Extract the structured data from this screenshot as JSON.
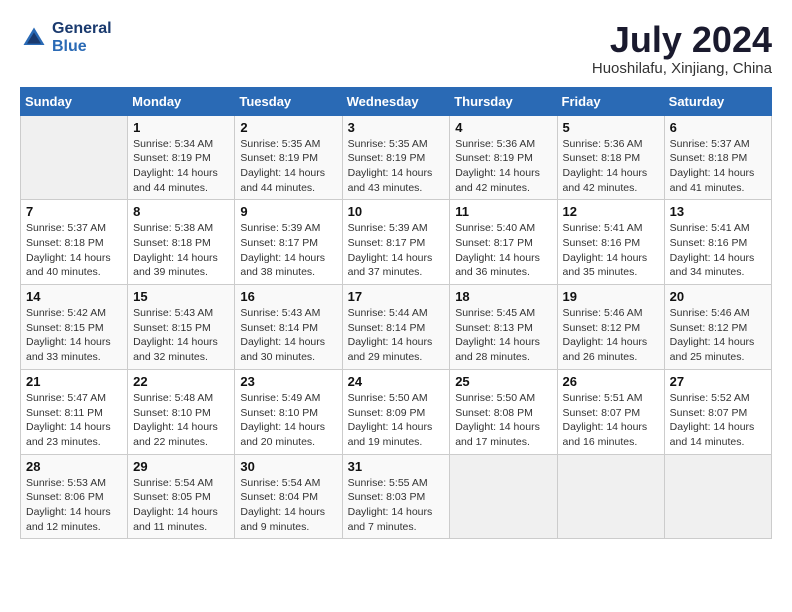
{
  "header": {
    "logo_line1": "General",
    "logo_line2": "Blue",
    "month": "July 2024",
    "location": "Huoshilafu, Xinjiang, China"
  },
  "weekdays": [
    "Sunday",
    "Monday",
    "Tuesday",
    "Wednesday",
    "Thursday",
    "Friday",
    "Saturday"
  ],
  "weeks": [
    [
      {
        "day": "",
        "info": ""
      },
      {
        "day": "1",
        "info": "Sunrise: 5:34 AM\nSunset: 8:19 PM\nDaylight: 14 hours\nand 44 minutes."
      },
      {
        "day": "2",
        "info": "Sunrise: 5:35 AM\nSunset: 8:19 PM\nDaylight: 14 hours\nand 44 minutes."
      },
      {
        "day": "3",
        "info": "Sunrise: 5:35 AM\nSunset: 8:19 PM\nDaylight: 14 hours\nand 43 minutes."
      },
      {
        "day": "4",
        "info": "Sunrise: 5:36 AM\nSunset: 8:19 PM\nDaylight: 14 hours\nand 42 minutes."
      },
      {
        "day": "5",
        "info": "Sunrise: 5:36 AM\nSunset: 8:18 PM\nDaylight: 14 hours\nand 42 minutes."
      },
      {
        "day": "6",
        "info": "Sunrise: 5:37 AM\nSunset: 8:18 PM\nDaylight: 14 hours\nand 41 minutes."
      }
    ],
    [
      {
        "day": "7",
        "info": "Sunrise: 5:37 AM\nSunset: 8:18 PM\nDaylight: 14 hours\nand 40 minutes."
      },
      {
        "day": "8",
        "info": "Sunrise: 5:38 AM\nSunset: 8:18 PM\nDaylight: 14 hours\nand 39 minutes."
      },
      {
        "day": "9",
        "info": "Sunrise: 5:39 AM\nSunset: 8:17 PM\nDaylight: 14 hours\nand 38 minutes."
      },
      {
        "day": "10",
        "info": "Sunrise: 5:39 AM\nSunset: 8:17 PM\nDaylight: 14 hours\nand 37 minutes."
      },
      {
        "day": "11",
        "info": "Sunrise: 5:40 AM\nSunset: 8:17 PM\nDaylight: 14 hours\nand 36 minutes."
      },
      {
        "day": "12",
        "info": "Sunrise: 5:41 AM\nSunset: 8:16 PM\nDaylight: 14 hours\nand 35 minutes."
      },
      {
        "day": "13",
        "info": "Sunrise: 5:41 AM\nSunset: 8:16 PM\nDaylight: 14 hours\nand 34 minutes."
      }
    ],
    [
      {
        "day": "14",
        "info": "Sunrise: 5:42 AM\nSunset: 8:15 PM\nDaylight: 14 hours\nand 33 minutes."
      },
      {
        "day": "15",
        "info": "Sunrise: 5:43 AM\nSunset: 8:15 PM\nDaylight: 14 hours\nand 32 minutes."
      },
      {
        "day": "16",
        "info": "Sunrise: 5:43 AM\nSunset: 8:14 PM\nDaylight: 14 hours\nand 30 minutes."
      },
      {
        "day": "17",
        "info": "Sunrise: 5:44 AM\nSunset: 8:14 PM\nDaylight: 14 hours\nand 29 minutes."
      },
      {
        "day": "18",
        "info": "Sunrise: 5:45 AM\nSunset: 8:13 PM\nDaylight: 14 hours\nand 28 minutes."
      },
      {
        "day": "19",
        "info": "Sunrise: 5:46 AM\nSunset: 8:12 PM\nDaylight: 14 hours\nand 26 minutes."
      },
      {
        "day": "20",
        "info": "Sunrise: 5:46 AM\nSunset: 8:12 PM\nDaylight: 14 hours\nand 25 minutes."
      }
    ],
    [
      {
        "day": "21",
        "info": "Sunrise: 5:47 AM\nSunset: 8:11 PM\nDaylight: 14 hours\nand 23 minutes."
      },
      {
        "day": "22",
        "info": "Sunrise: 5:48 AM\nSunset: 8:10 PM\nDaylight: 14 hours\nand 22 minutes."
      },
      {
        "day": "23",
        "info": "Sunrise: 5:49 AM\nSunset: 8:10 PM\nDaylight: 14 hours\nand 20 minutes."
      },
      {
        "day": "24",
        "info": "Sunrise: 5:50 AM\nSunset: 8:09 PM\nDaylight: 14 hours\nand 19 minutes."
      },
      {
        "day": "25",
        "info": "Sunrise: 5:50 AM\nSunset: 8:08 PM\nDaylight: 14 hours\nand 17 minutes."
      },
      {
        "day": "26",
        "info": "Sunrise: 5:51 AM\nSunset: 8:07 PM\nDaylight: 14 hours\nand 16 minutes."
      },
      {
        "day": "27",
        "info": "Sunrise: 5:52 AM\nSunset: 8:07 PM\nDaylight: 14 hours\nand 14 minutes."
      }
    ],
    [
      {
        "day": "28",
        "info": "Sunrise: 5:53 AM\nSunset: 8:06 PM\nDaylight: 14 hours\nand 12 minutes."
      },
      {
        "day": "29",
        "info": "Sunrise: 5:54 AM\nSunset: 8:05 PM\nDaylight: 14 hours\nand 11 minutes."
      },
      {
        "day": "30",
        "info": "Sunrise: 5:54 AM\nSunset: 8:04 PM\nDaylight: 14 hours\nand 9 minutes."
      },
      {
        "day": "31",
        "info": "Sunrise: 5:55 AM\nSunset: 8:03 PM\nDaylight: 14 hours\nand 7 minutes."
      },
      {
        "day": "",
        "info": ""
      },
      {
        "day": "",
        "info": ""
      },
      {
        "day": "",
        "info": ""
      }
    ]
  ]
}
